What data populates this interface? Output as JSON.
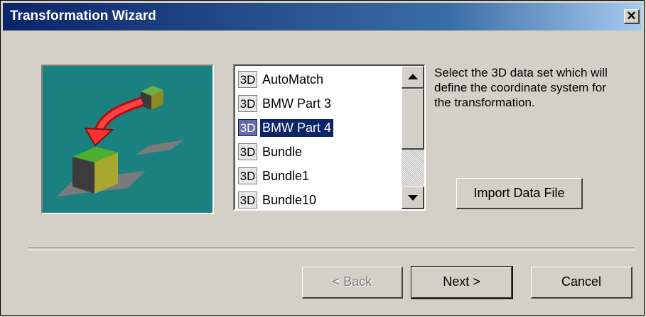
{
  "window": {
    "title": "Transformation Wizard",
    "close_label": "✕"
  },
  "list": {
    "badge": "3D",
    "items": [
      {
        "label": "AutoMatch",
        "selected": false
      },
      {
        "label": "BMW Part 3",
        "selected": false
      },
      {
        "label": "BMW Part 4",
        "selected": true
      },
      {
        "label": "Bundle",
        "selected": false
      },
      {
        "label": "Bundle1",
        "selected": false
      },
      {
        "label": "Bundle10",
        "selected": false
      }
    ]
  },
  "description": "Select the 3D data set which will define the coordinate system for the transformation.",
  "buttons": {
    "import_label": "Import Data File",
    "back_label": "< Back",
    "next_label": "Next >",
    "cancel_label": "Cancel"
  },
  "colors": {
    "title_bar": "#0a246a",
    "illustration_bg": "#1a8080",
    "selection": "#0a246a"
  },
  "icons": [
    "close-icon",
    "scroll-up-icon",
    "scroll-down-icon",
    "transform-illustration"
  ]
}
